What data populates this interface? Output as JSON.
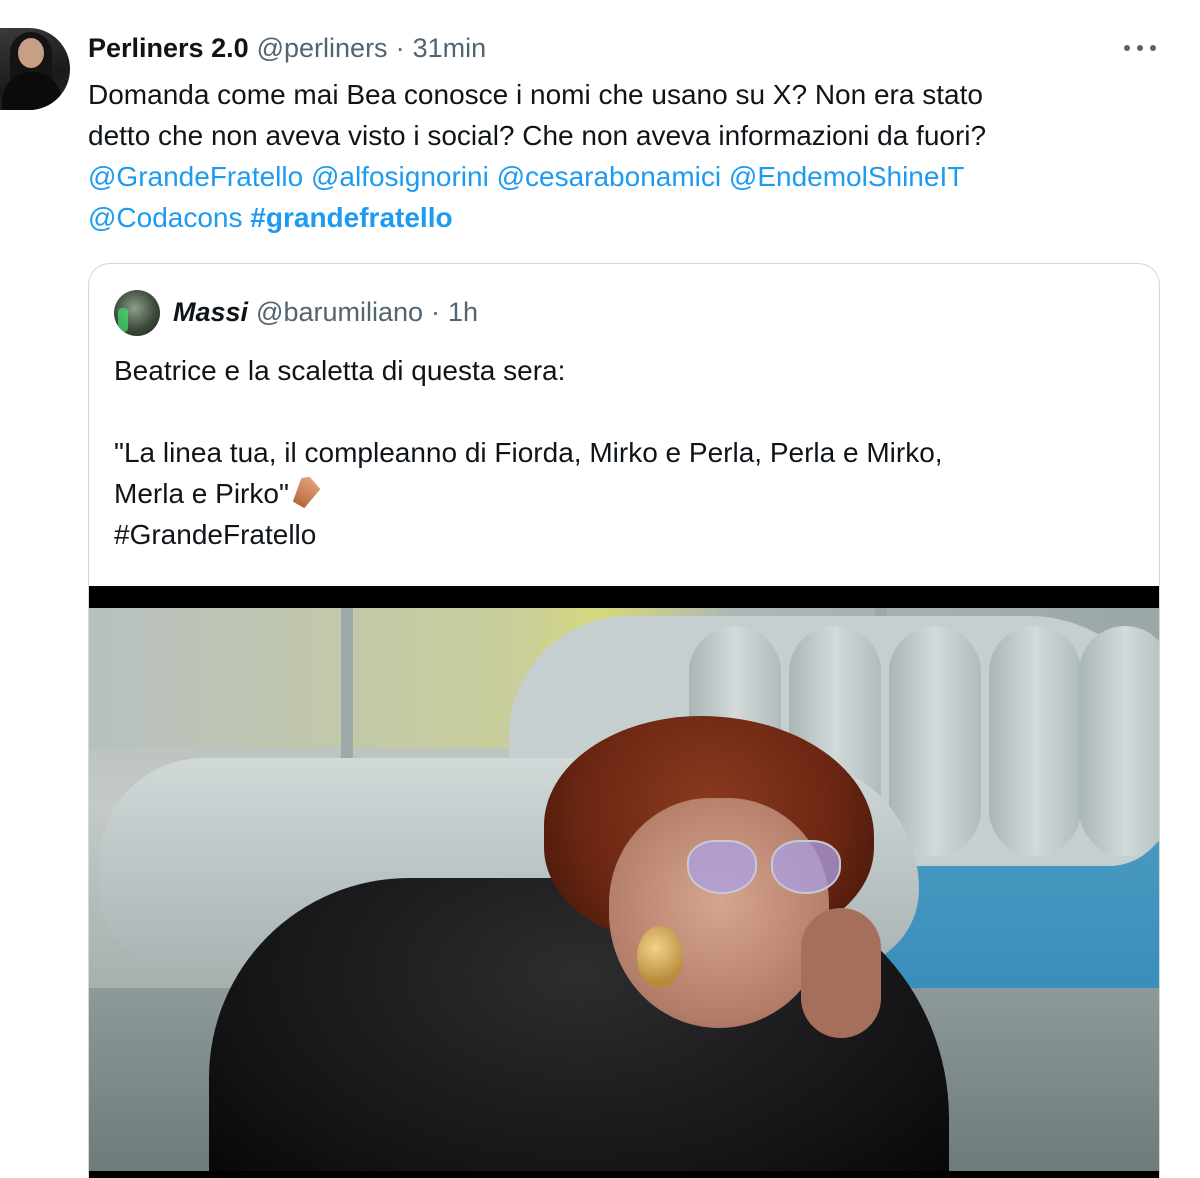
{
  "tweet": {
    "author_name": "Perliners 2.0",
    "author_handle": "@perliners",
    "separator": "·",
    "time": "31min",
    "more_icon": "more-horizontal-icon",
    "text_line_1": "Domanda come mai Bea conosce i nomi che usano su X? Non era stato",
    "text_line_2": "detto che non aveva visto i social? Che non aveva informazioni da fuori?",
    "mentions": [
      "@GrandeFratello",
      "@alfosignorini",
      "@cesarabonamici",
      "@EndemolShineIT",
      "@Codacons"
    ],
    "hashtag": "#grandefratello"
  },
  "quote": {
    "author_name": "Massi",
    "author_handle": "@barumiliano",
    "separator": "·",
    "time": "1h",
    "line_1": "Beatrice e la scaletta di questa sera:",
    "line_2": "\"La linea tua, il compleanno di Fiorda, Mirko e Perla, Perla e Mirko,",
    "line_3": "Merla e Pirko\"",
    "emoji": "coffin-emoji",
    "hashtag": "#GrandeFratello",
    "media": "tv-still-woman-red-curly-hair-heart-sunglasses-leather-jacket-on-sofa"
  }
}
